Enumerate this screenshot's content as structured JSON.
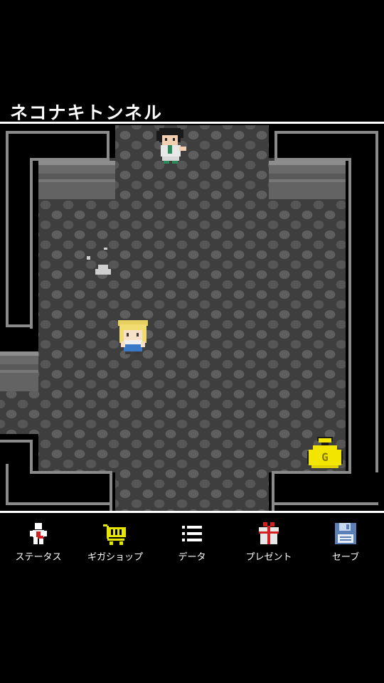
{
  "location": {
    "name": "ネコナキトンネル"
  },
  "map": {
    "floor_color": "#4a4a4a",
    "wall_color": "#000000",
    "wall_edge_color": "#8a8a8a"
  },
  "sprites": {
    "npc": "dark-haired-npc",
    "player": "blonde-player",
    "gold_bag_icon": "gold-bag-icon",
    "gold_bag_letter": "G"
  },
  "menu": {
    "items": [
      {
        "label": "ステータス",
        "icon": "status-figure-icon"
      },
      {
        "label": "ギガショップ",
        "icon": "shopping-cart-icon"
      },
      {
        "label": "データ",
        "icon": "list-icon"
      },
      {
        "label": "プレゼント",
        "icon": "gift-box-icon"
      },
      {
        "label": "セーブ",
        "icon": "floppy-disk-icon"
      }
    ]
  },
  "colors": {
    "cart": "#e6e600",
    "gift": "#e8e8e8",
    "gift_ribbon": "#d42020",
    "floppy": "#5d7fb8",
    "gold": "#f2e600"
  }
}
